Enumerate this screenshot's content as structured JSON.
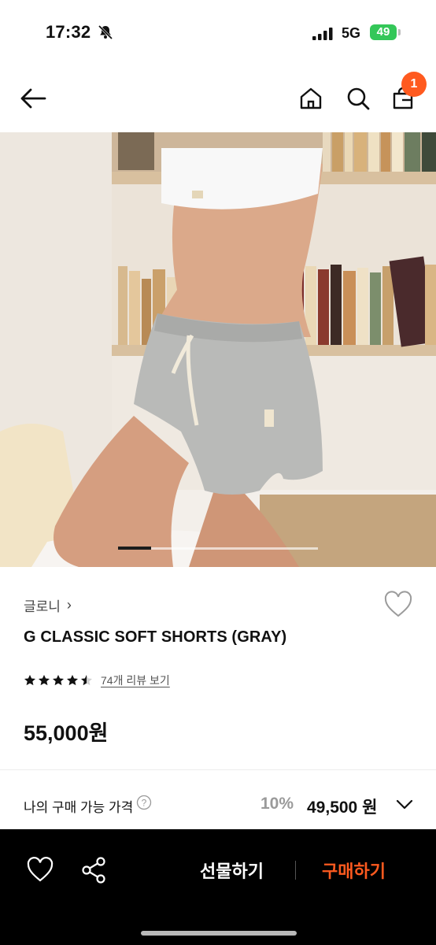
{
  "status_bar": {
    "time": "17:32",
    "network": "5G",
    "battery": "49"
  },
  "header": {
    "cart_count": "1"
  },
  "product": {
    "brand": "글로니",
    "name": "G CLASSIC SOFT SHORTS (GRAY)",
    "rating": 4.5,
    "review_link": "74개 리뷰 보기",
    "price": "55,000원",
    "image_page": 1,
    "image_count": 6
  },
  "my_price": {
    "label": "나의 구매 가능 가격",
    "discount": "10%",
    "price": "49,500 원"
  },
  "bottom_bar": {
    "gift_label": "선물하기",
    "buy_label": "구매하기"
  },
  "colors": {
    "accent": "#ff5a1f",
    "battery": "#34c759",
    "bottom_bar": "#000000"
  },
  "icons": [
    "back-arrow-icon",
    "home-icon",
    "search-icon",
    "shopping-bag-icon",
    "heart-icon",
    "help-icon",
    "chevron-down-icon",
    "share-icon",
    "bell-slash-icon",
    "signal-icon",
    "battery-icon"
  ]
}
